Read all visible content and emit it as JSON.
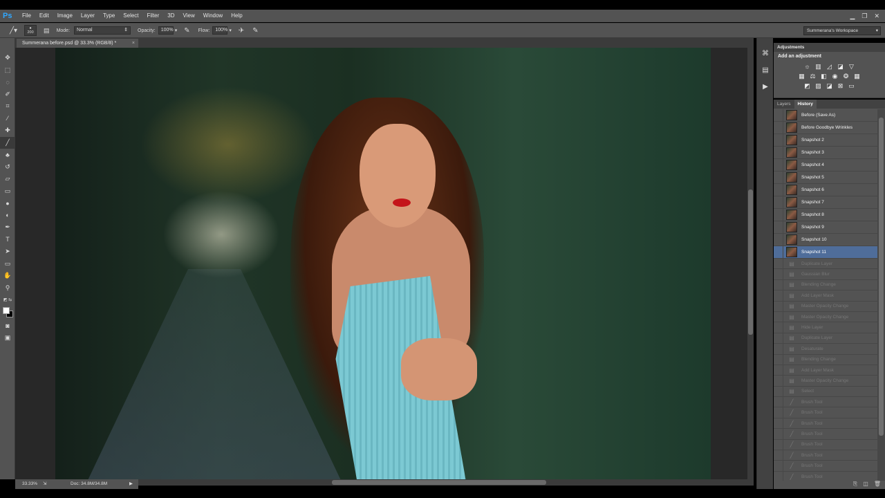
{
  "app": {
    "logo": "Ps"
  },
  "menu": [
    "File",
    "Edit",
    "Image",
    "Layer",
    "Type",
    "Select",
    "Filter",
    "3D",
    "View",
    "Window",
    "Help"
  ],
  "window_controls": {
    "minimize": "▁",
    "restore": "❐",
    "close": "✕"
  },
  "options": {
    "brush_size": "200",
    "mode_label": "Mode:",
    "mode_value": "Normal",
    "opacity_label": "Opacity:",
    "opacity_value": "100%",
    "flow_label": "Flow:",
    "flow_value": "100%",
    "workspace": "Summerana's Workspace"
  },
  "document": {
    "tab_title": "Summerana before.psd @ 33.3% (RGB/8) *",
    "close": "×"
  },
  "status": {
    "zoom": "33.33%",
    "doc_info": "Doc: 34.8M/34.8M"
  },
  "adjustments": {
    "title": "Adjustments",
    "subtitle": "Add an adjustment"
  },
  "history": {
    "tabs": [
      "Layers",
      "History"
    ],
    "active_tab": "History",
    "items": [
      "Before (Save As)",
      "Before Goodbye Wrinkles",
      "Snapshot 2",
      "Snapshot 3",
      "Snapshot 4",
      "Snapshot 5",
      "Snapshot 6",
      "Snapshot 7",
      "Snapshot 8",
      "Snapshot 9",
      "Snapshot 10",
      "Snapshot 11"
    ],
    "selected_index": 11,
    "steps": [
      "Duplicate Layer",
      "Gaussian Blur",
      "Blending Change",
      "Add Layer Mask",
      "Master Opacity Change",
      "Master Opacity Change",
      "Hide Layer",
      "Duplicate Layer",
      "Desaturate",
      "Blending Change",
      "Add Layer Mask",
      "Master Opacity Change",
      "Select",
      "Brush Tool",
      "Brush Tool",
      "Brush Tool",
      "Brush Tool",
      "Brush Tool",
      "Brush Tool",
      "Brush Tool",
      "Brush Tool"
    ]
  },
  "icons": {
    "tools": [
      "move-icon",
      "marquee-icon",
      "lasso-icon",
      "quick-select-icon",
      "crop-icon",
      "eyedropper-icon",
      "healing-icon",
      "brush-icon",
      "stamp-icon",
      "history-brush-icon",
      "eraser-icon",
      "gradient-icon",
      "blur-icon",
      "dodge-icon",
      "pen-icon",
      "type-icon",
      "path-select-icon",
      "shape-icon",
      "hand-icon",
      "zoom-icon"
    ]
  }
}
